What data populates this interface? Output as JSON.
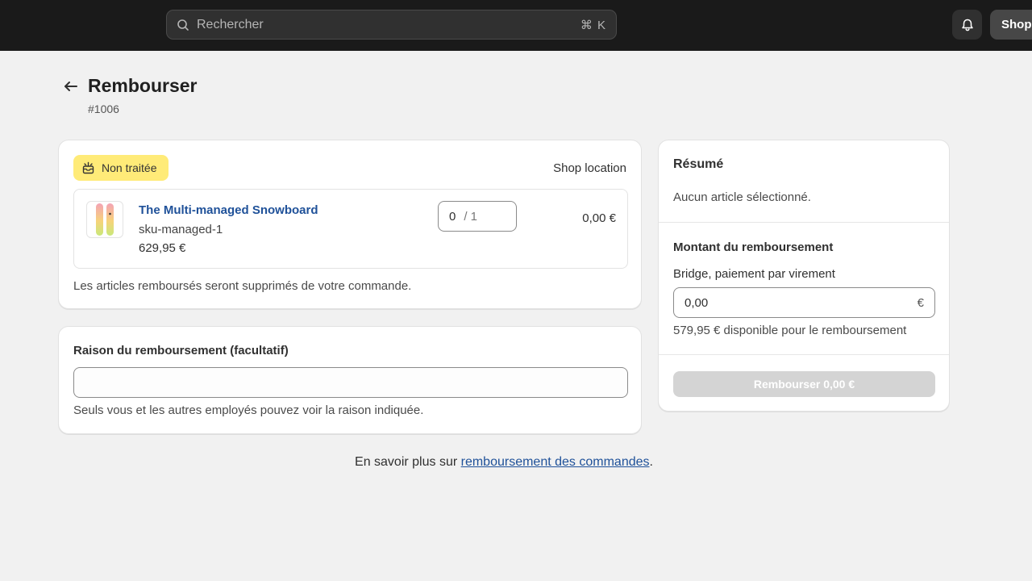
{
  "topbar": {
    "search_placeholder": "Rechercher",
    "shortcut": "⌘ K",
    "shop_label": "Shop"
  },
  "header": {
    "title": "Rembourser",
    "order_number": "#1006"
  },
  "items_card": {
    "status_badge": "Non traitée",
    "location": "Shop location",
    "line_item": {
      "name": "The Multi-managed Snowboard",
      "sku": "sku-managed-1",
      "price": "629,95 €",
      "quantity_value": "0",
      "quantity_total": "/ 1",
      "line_total": "0,00 €"
    },
    "note": "Les articles remboursés seront supprimés de votre commande."
  },
  "reason_card": {
    "label": "Raison du remboursement (facultatif)",
    "value": "",
    "help": "Seuls vous et les autres employés pouvez voir la raison indiquée."
  },
  "summary": {
    "title": "Résumé",
    "empty_text": "Aucun article sélectionné.",
    "amount_title": "Montant du remboursement",
    "payment_method": "Bridge, paiement par virement",
    "amount_value": "0,00",
    "currency": "€",
    "available": "579,95 € disponible pour le remboursement",
    "refund_button": "Rembourser 0,00 €"
  },
  "footer": {
    "prefix": "En savoir plus sur ",
    "link": "remboursement des commandes",
    "suffix": "."
  },
  "colors": {
    "topbar": "#1a1a1a",
    "badge": "#ffeb78",
    "link": "#1f5199",
    "disabled_button": "#d4d4d4"
  }
}
